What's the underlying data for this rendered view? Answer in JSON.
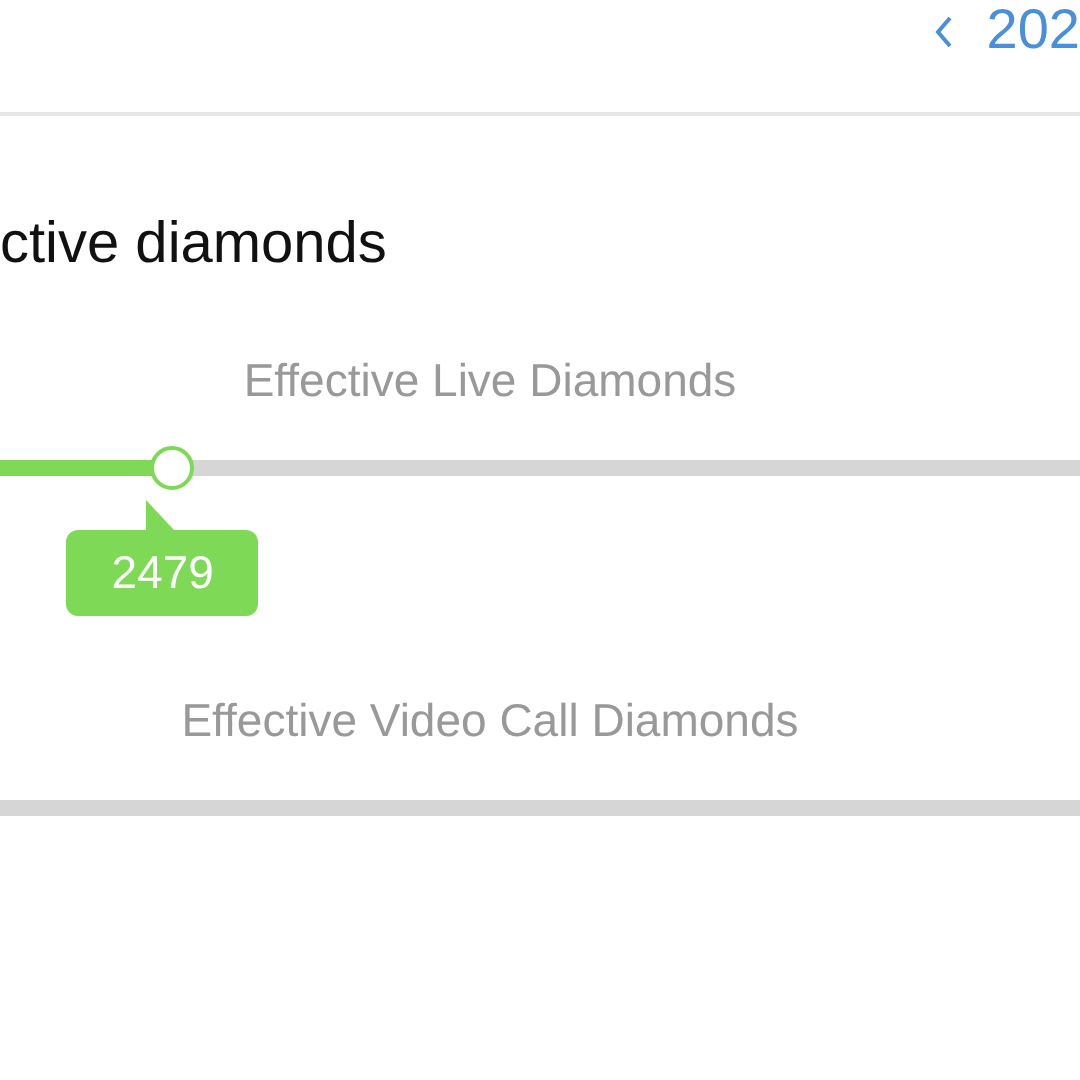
{
  "header": {
    "date_text": "202"
  },
  "section": {
    "title": "ctive diamonds"
  },
  "sliders": [
    {
      "label": "Effective Live Diamonds",
      "level": 0.16,
      "value_tooltip": "2479"
    },
    {
      "label": "Effective Video Call Diamonds"
    }
  ]
}
